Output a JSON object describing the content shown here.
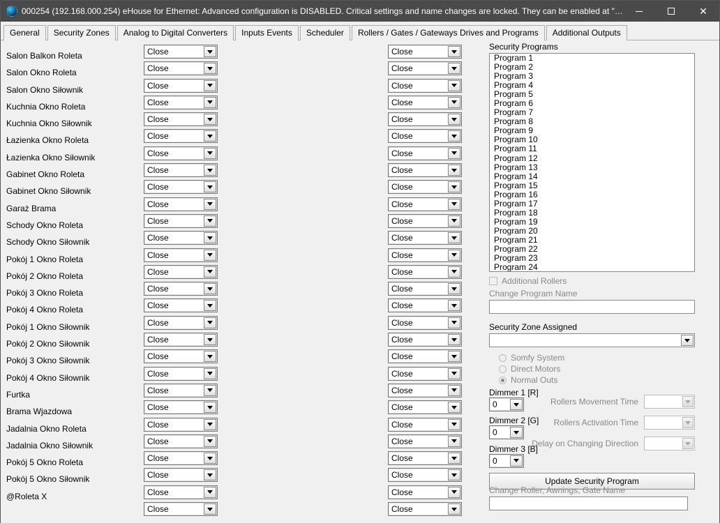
{
  "title": "000254 (192.168.000.254)     eHouse for Ethernet: Advanced configuration is DISABLED. Critical settings and name changes are locked. They can be enabled at \"Gen...",
  "tabs": [
    "General",
    "Security Zones",
    "Analog to Digital Converters",
    "Inputs Events",
    "Scheduler",
    "Rollers / Gates / Gateways Drives  and Programs",
    "Additional Outputs"
  ],
  "active_tab": 5,
  "roller_labels": [
    "Salon Balkon Roleta",
    "Salon Okno Roleta",
    "Salon Okno Siłownik",
    "Kuchnia Okno Roleta",
    "Kuchnia Okno Siłownik",
    "Łazienka Okno Roleta",
    "Łazienka Okno Siłownik",
    "Gabinet Okno Roleta",
    "Gabinet Okno Siłownik",
    "Garaż Brama",
    "Schody Okno Roleta",
    "Schody Okno Siłownik",
    "Pokój 1 Okno Roleta",
    "Pokój 2 Okno Roleta",
    "Pokój 3 Okno Roleta",
    "Pokój 4 Okno Roleta",
    "Pokój 1 Okno Siłownik",
    "Pokój 2 Okno Siłownik",
    "Pokój 3 Okno Siłownik",
    "Pokój 4 Okno Siłownik",
    "Furtka",
    "Brama Wjazdowa",
    "Jadalnia Okno Roleta",
    "Jadalnia Okno Siłownik",
    "Pokój 5 Okno Roleta",
    "Pokój 5 Okno Siłownik",
    "@Roleta X"
  ],
  "combo_value": "Close",
  "combo_count": 28,
  "programs_label": "Security Programs",
  "programs": [
    "Program 1",
    "Program 2",
    "Program 3",
    "Program 4",
    "Program 5",
    "Program 6",
    "Program 7",
    "Program 8",
    "Program 9",
    "Program 10",
    "Program 11",
    "Program 12",
    "Program 13",
    "Program 14",
    "Program 15",
    "Program 16",
    "Program 17",
    "Program 18",
    "Program 19",
    "Program 20",
    "Program 21",
    "Program 22",
    "Program 23",
    "Program 24"
  ],
  "additional_rollers": "Additional Rollers",
  "change_prog": "Change Program Name",
  "zone_label": "Security Zone Assigned",
  "radios": [
    "Somfy System",
    "Direct Motors",
    "Normal Outs"
  ],
  "radio_selected": 2,
  "dimmers": [
    {
      "label": "Dimmer 1 [R]",
      "value": "0"
    },
    {
      "label": "Dimmer 2 [G]",
      "value": "0"
    },
    {
      "label": "Dimmer 3 [B]",
      "value": "0"
    }
  ],
  "timing": [
    {
      "label": "Rollers Movement Time",
      "value": ""
    },
    {
      "label": "Rollers Activation Time",
      "value": ""
    },
    {
      "label": "Delay on Changing Direction",
      "value": ""
    }
  ],
  "update_btn": "Update Security Program",
  "change_roller": "Change Roller, Awnings, Gate Name"
}
